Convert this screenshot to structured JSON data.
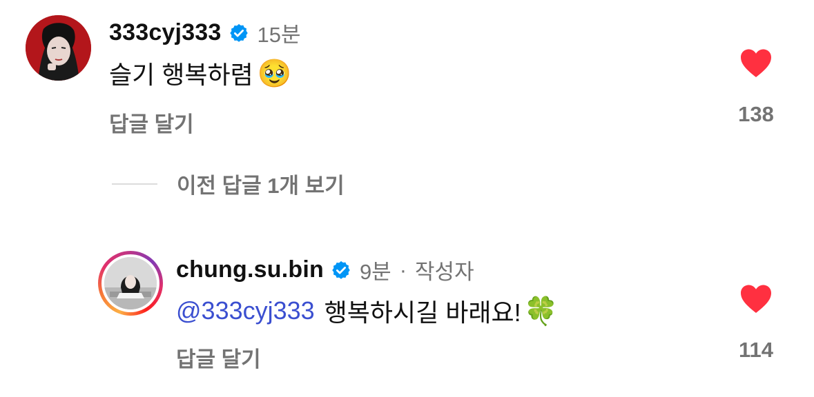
{
  "comments": [
    {
      "username": "333cyj333",
      "verified": true,
      "time": "15분",
      "text": "슬기 행복하렴",
      "emoji": "🥹",
      "reply_label": "답글 달기",
      "like_count": "138",
      "liked": true
    },
    {
      "username": "chung.su.bin",
      "verified": true,
      "time": "9분",
      "separator": "·",
      "author_tag": "작성자",
      "mention": "@333cyj333",
      "text": "행복하시길 바래요!",
      "emoji": "🍀",
      "reply_label": "답글 달기",
      "like_count": "114",
      "liked": true
    }
  ],
  "view_previous_replies": "이전 답글 1개 보기",
  "colors": {
    "like_red": "#ff3040",
    "verified_blue": "#0095f6",
    "mention_blue": "#3b4fd0",
    "muted_text": "#737373"
  }
}
